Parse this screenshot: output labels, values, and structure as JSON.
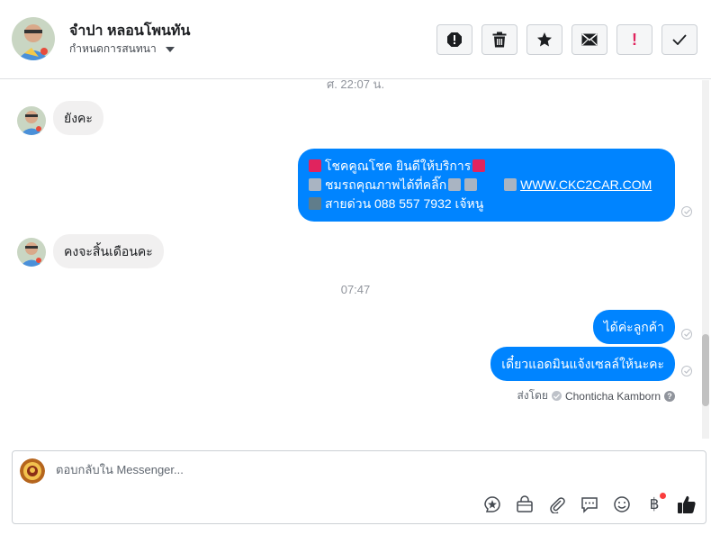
{
  "header": {
    "name": "จำปา หลอนโพนทัน",
    "subtitle": "กำหนดการสนทนา",
    "toolbar": [
      {
        "icon": "spam-octagon-icon"
      },
      {
        "icon": "trash-icon"
      },
      {
        "icon": "star-icon"
      },
      {
        "icon": "envelope-icon"
      },
      {
        "icon": "exclamation-icon",
        "label": "!"
      },
      {
        "icon": "checkmark-icon"
      }
    ]
  },
  "thread": {
    "timestamp_top": "ศ. 22:07 น.",
    "timestamp_mid": "07:47",
    "messages": [
      {
        "direction": "in",
        "text": "ยังคะ"
      },
      {
        "direction": "out",
        "line1": "โชคคูณโชค ยินดีให้บริการ",
        "line2": "ชมรถคุณภาพได้ที่คลิ๊ก",
        "link": "WWW.CKC2CAR.COM",
        "line3": "สายด่วน 088 557 7932 เจ้หนู"
      },
      {
        "direction": "in",
        "text": "คงจะสิ้นเดือนคะ"
      },
      {
        "direction": "out",
        "text": "ได้ค่ะลูกค้า"
      },
      {
        "direction": "out",
        "text": "เดี๋ยวแอดมินแจ้งเซลล์ให้นะคะ"
      }
    ],
    "sent_by_label": "ส่งโดย",
    "sent_by_name": "Chonticha Kamborn"
  },
  "composer": {
    "placeholder": "ตอบกลับใน Messenger...",
    "icons": [
      "sticker-icon",
      "shopping-bag-icon",
      "paperclip-icon",
      "chat-bubble-icon",
      "smiley-icon",
      "baht-icon",
      "thumbs-up-icon"
    ],
    "baht_symbol": "฿"
  },
  "colors": {
    "accent": "#0084ff",
    "incoming_bubble": "#f1f0f0",
    "alert_red": "#e0245e"
  }
}
